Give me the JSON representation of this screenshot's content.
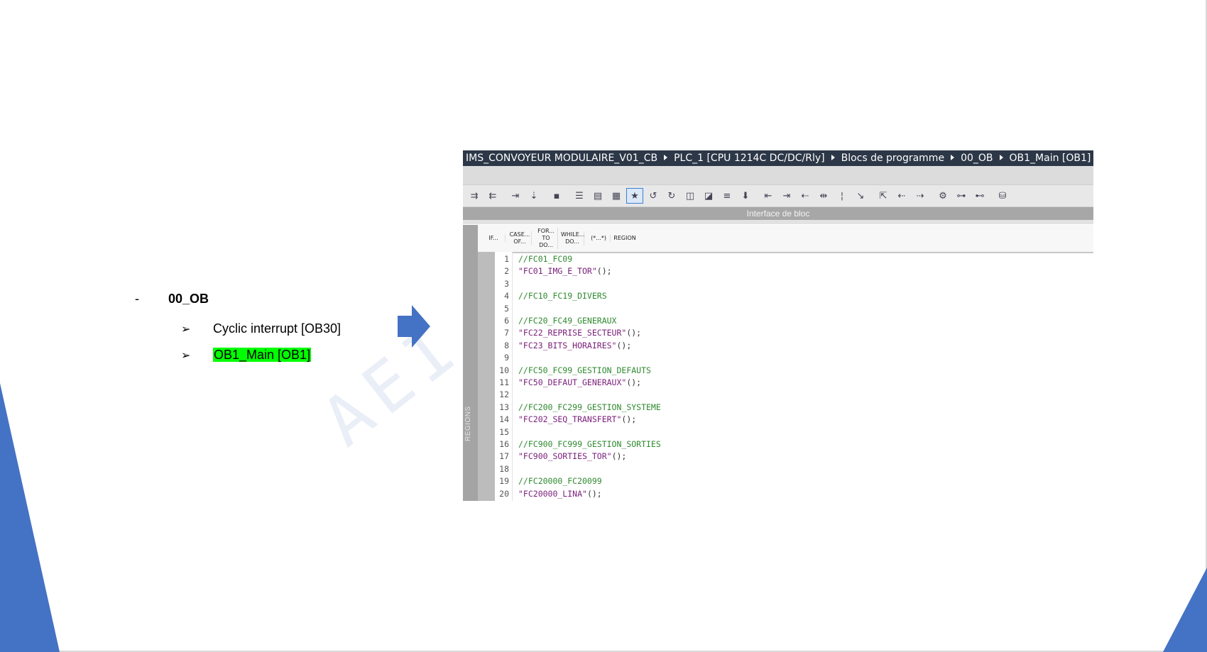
{
  "slide": {
    "watermark": "AEI F",
    "level1": {
      "dash": "-",
      "label": "00_OB"
    },
    "items": [
      {
        "label": "Cyclic interrupt [OB30]",
        "highlighted": false
      },
      {
        "label": "OB1_Main [OB1]",
        "highlighted": true
      }
    ],
    "highlight_color": "#00ff00",
    "accent_color": "#4472c4"
  },
  "tia": {
    "breadcrumb": [
      "IMS_CONVOYEUR MODULAIRE_V01_CB",
      "PLC_1 [CPU 1214C DC/DC/Rly]",
      "Blocs de programme",
      "00_OB",
      "OB1_Main [OB1]"
    ],
    "interface_label": "Interface de bloc",
    "regions_label": "REGIONS",
    "scl_toolbar": [
      {
        "l1": "IF...",
        "l2": ""
      },
      {
        "l1": "CASE...",
        "l2": "OF..."
      },
      {
        "l1": "FOR...",
        "l2": "TO DO..."
      },
      {
        "l1": "WHILE...",
        "l2": "DO..."
      },
      {
        "l1": "(*...*)",
        "l2": ""
      },
      {
        "l1": "REGION",
        "l2": ""
      }
    ],
    "code": [
      {
        "n": "1",
        "type": "comment",
        "text": "//FC01_FC09"
      },
      {
        "n": "2",
        "type": "call",
        "text": "\"FC01_IMG_E_TOR\""
      },
      {
        "n": "3",
        "type": "blank",
        "text": ""
      },
      {
        "n": "4",
        "type": "comment",
        "text": "//FC10_FC19_DIVERS"
      },
      {
        "n": "5",
        "type": "blank",
        "text": ""
      },
      {
        "n": "6",
        "type": "comment",
        "text": "//FC20_FC49_GENERAUX"
      },
      {
        "n": "7",
        "type": "call",
        "text": "\"FC22_REPRISE_SECTEUR\""
      },
      {
        "n": "8",
        "type": "call",
        "text": "\"FC23_BITS_HORAIRES\""
      },
      {
        "n": "9",
        "type": "blank",
        "text": ""
      },
      {
        "n": "10",
        "type": "comment",
        "text": "//FC50_FC99_GESTION_DEFAUTS"
      },
      {
        "n": "11",
        "type": "call",
        "text": "\"FC50_DEFAUT_GENERAUX\""
      },
      {
        "n": "12",
        "type": "blank",
        "text": ""
      },
      {
        "n": "13",
        "type": "comment",
        "text": "//FC200_FC299_GESTION_SYSTEME"
      },
      {
        "n": "14",
        "type": "call",
        "text": "\"FC202_SEQ_TRANSFERT\""
      },
      {
        "n": "15",
        "type": "blank",
        "text": ""
      },
      {
        "n": "16",
        "type": "comment",
        "text": "//FC900_FC999_GESTION_SORTIES"
      },
      {
        "n": "17",
        "type": "call",
        "text": "\"FC900_SORTIES_TOR\""
      },
      {
        "n": "18",
        "type": "blank",
        "text": ""
      },
      {
        "n": "19",
        "type": "comment",
        "text": "//FC20000_FC20099"
      },
      {
        "n": "20",
        "type": "call",
        "text": "\"FC20000_LINA\""
      }
    ],
    "call_suffix": "();"
  }
}
